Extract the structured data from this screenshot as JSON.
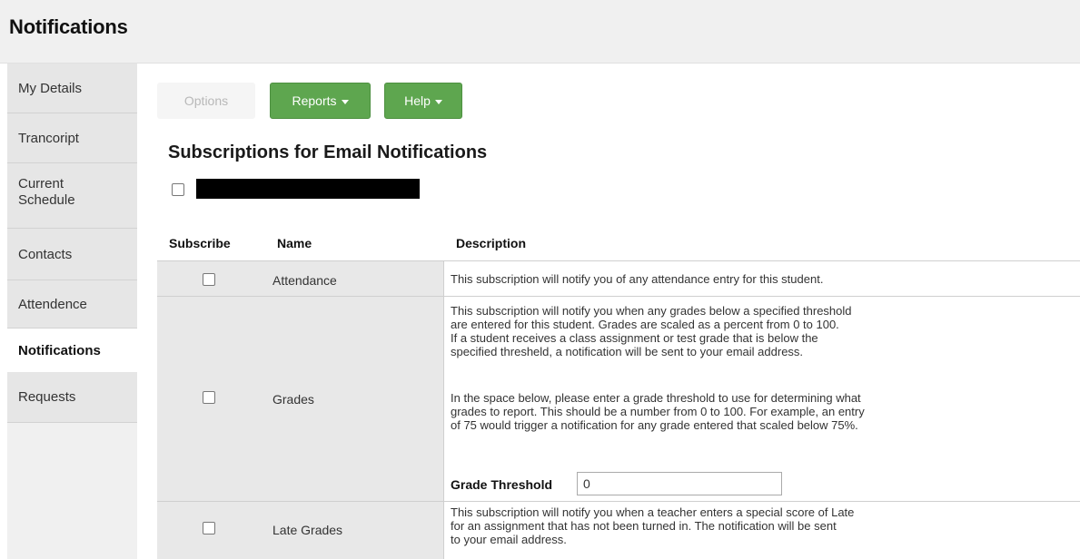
{
  "app": {
    "title": "Notifications"
  },
  "sidebar": {
    "items": [
      {
        "label": "My Details"
      },
      {
        "label": "Trancoript"
      },
      {
        "label": "Current\nSchedule"
      },
      {
        "label": "Contacts"
      },
      {
        "label": "Attendence"
      },
      {
        "label": "Notifications"
      },
      {
        "label": "Requests"
      }
    ]
  },
  "toolbar": {
    "options_label": "Options",
    "reports_label": "Reports",
    "help_label": "Help"
  },
  "section": {
    "title": "Subscriptions for Email Notifications"
  },
  "table": {
    "headers": {
      "subscribe": "Subscribe",
      "name": "Name",
      "description": "Description"
    },
    "rows": [
      {
        "name": "Attendance",
        "description": "This subscription will notify you of any attendance entry for this student."
      },
      {
        "name": "Grades",
        "description_p1": "This subscription will notify you when any grades below a specified threshold\nare entered for this student. Grades are scaled as a percent from 0 to 100.\nIf a student receives a class assignment or test grade that is below the\nspecified thresheld, a notification will be sent to your email address.",
        "description_p2": "In the space below, please enter a grade threshold to use for determining what\ngrades to report. This should be a number from 0 to 100. For example, an entry\nof 75 would trigger a notification for any grade entered that scaled below 75%.",
        "threshold_label": "Grade Threshold",
        "threshold_value": "0"
      },
      {
        "name": "Late Grades",
        "description": "This subscription will notify you when a teacher enters a special score of Late\nfor an assignment that has not been turned in. The notification will be sent\nto your email address."
      }
    ]
  }
}
